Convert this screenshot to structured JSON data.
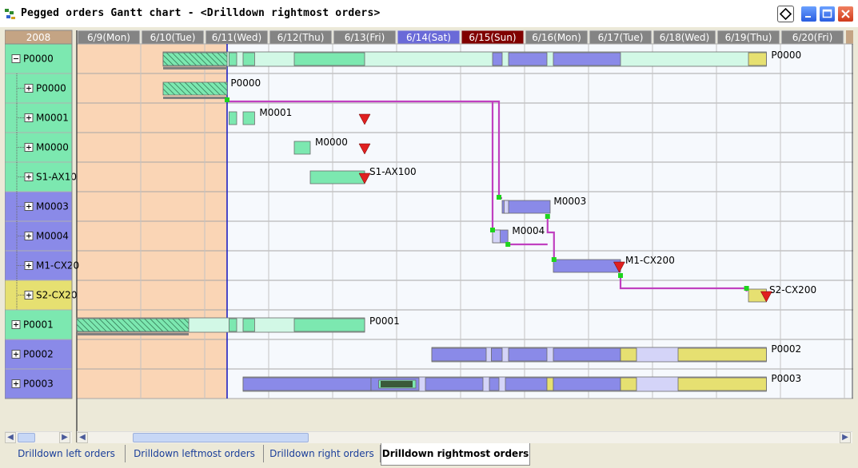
{
  "window": {
    "title": "Pegged orders Gantt chart - <Drilldown rightmost orders>"
  },
  "year_label": "2008",
  "dates": [
    {
      "label": "6/9(Mon)",
      "kind": "weekday"
    },
    {
      "label": "6/10(Tue)",
      "kind": "weekday"
    },
    {
      "label": "6/11(Wed)",
      "kind": "weekday"
    },
    {
      "label": "6/12(Thu)",
      "kind": "weekday"
    },
    {
      "label": "6/13(Fri)",
      "kind": "weekday"
    },
    {
      "label": "6/14(Sat)",
      "kind": "saturday"
    },
    {
      "label": "6/15(Sun)",
      "kind": "sunday"
    },
    {
      "label": "6/16(Mon)",
      "kind": "weekday"
    },
    {
      "label": "6/17(Tue)",
      "kind": "weekday"
    },
    {
      "label": "6/18(Wed)",
      "kind": "weekday"
    },
    {
      "label": "6/19(Thu)",
      "kind": "weekday"
    },
    {
      "label": "6/20(Fri)",
      "kind": "weekday"
    }
  ],
  "colors": {
    "green": "#7ce8b0",
    "green_light": "#d2f8e6",
    "blue": "#8a8ae8",
    "blue_light": "#d4d4f8",
    "yellow": "#e6e071",
    "yellow_light": "#f5f2b8",
    "past_fill": "#fad5b5",
    "link_line": "#c040c0",
    "deadline_marker": "#e02020",
    "today_line": "#2020c0",
    "sunday_header": "#800000",
    "saturday_header": "#6a6ad8",
    "weekday_header": "#848484",
    "year_header": "#c4a484"
  },
  "rows": [
    {
      "name": "P0000",
      "expander": "minus",
      "indent": 0,
      "label_bg": "green",
      "gantt_label": "P0000",
      "tree_line": false
    },
    {
      "name": "P0000",
      "expander": "plus",
      "indent": 1,
      "label_bg": "green",
      "gantt_label": "P0000",
      "tree_line": true
    },
    {
      "name": "M0001",
      "expander": "plus",
      "indent": 1,
      "label_bg": "green",
      "gantt_label": "M0001",
      "tree_line": true
    },
    {
      "name": "M0000",
      "expander": "plus",
      "indent": 1,
      "label_bg": "green",
      "gantt_label": "M0000",
      "tree_line": true
    },
    {
      "name": "S1-AX10",
      "expander": "plus",
      "indent": 1,
      "label_bg": "green",
      "gantt_label": "S1-AX100",
      "tree_line": true
    },
    {
      "name": "M0003",
      "expander": "plus",
      "indent": 1,
      "label_bg": "blue",
      "gantt_label": "M0003",
      "tree_line": true
    },
    {
      "name": "M0004",
      "expander": "plus",
      "indent": 1,
      "label_bg": "blue",
      "gantt_label": "M0004",
      "tree_line": true
    },
    {
      "name": "M1-CX20",
      "expander": "plus",
      "indent": 1,
      "label_bg": "blue",
      "gantt_label": "M1-CX200",
      "tree_line": true
    },
    {
      "name": "S2-CX20",
      "expander": "plus",
      "indent": 1,
      "label_bg": "yellow",
      "gantt_label": "S2-CX200",
      "tree_line": true
    },
    {
      "name": "P0001",
      "expander": "plus",
      "indent": 0,
      "label_bg": "green",
      "gantt_label": "P0001",
      "tree_line": false
    },
    {
      "name": "P0002",
      "expander": "plus",
      "indent": 0,
      "label_bg": "blue",
      "gantt_label": "P0002",
      "tree_line": false
    },
    {
      "name": "P0003",
      "expander": "plus",
      "indent": 0,
      "label_bg": "blue",
      "gantt_label": "P0003",
      "tree_line": false
    }
  ],
  "tabs": [
    {
      "label": "Drilldown left orders",
      "active": false
    },
    {
      "label": "Drilldown leftmost orders",
      "active": false
    },
    {
      "label": "Drilldown right orders",
      "active": false
    },
    {
      "label": "Drilldown rightmost orders",
      "active": true
    }
  ],
  "icons": {
    "scroll_left": "◀",
    "scroll_right": "▶",
    "expand": "+",
    "collapse": "−"
  }
}
